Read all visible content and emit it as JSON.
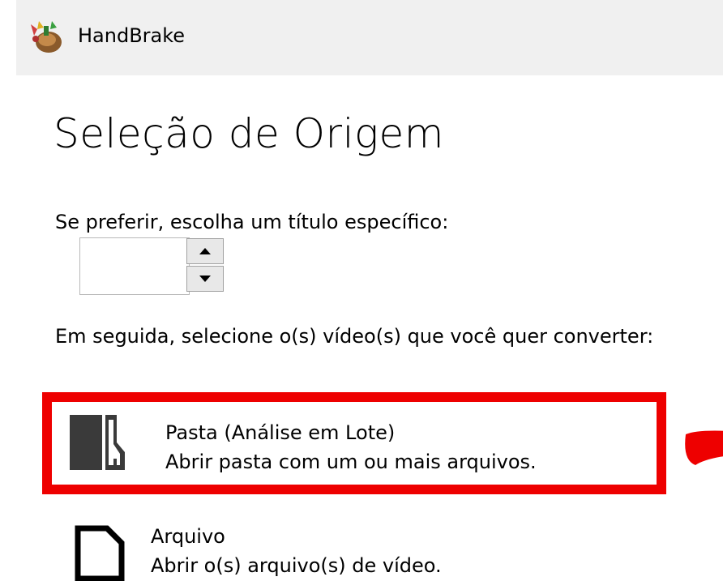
{
  "window": {
    "title": "HandBrake"
  },
  "main": {
    "heading": "Seleção de Origem",
    "title_prompt": "Se preferir, escolha um título específico:",
    "title_spinner_value": "",
    "next_prompt": "Em seguida, selecione o(s) vídeo(s) que você quer converter:",
    "options": [
      {
        "title": "Pasta (Análise em Lote)",
        "subtitle": "Abrir pasta com um ou mais arquivos.",
        "icon": "folder-icon"
      },
      {
        "title": "Arquivo",
        "subtitle": "Abrir o(s) arquivo(s) de vídeo.",
        "icon": "file-icon"
      }
    ]
  },
  "colors": {
    "highlight": "#ee0000",
    "titlebar": "#f0f0f0",
    "icon_fill": "#3a3a3a"
  }
}
